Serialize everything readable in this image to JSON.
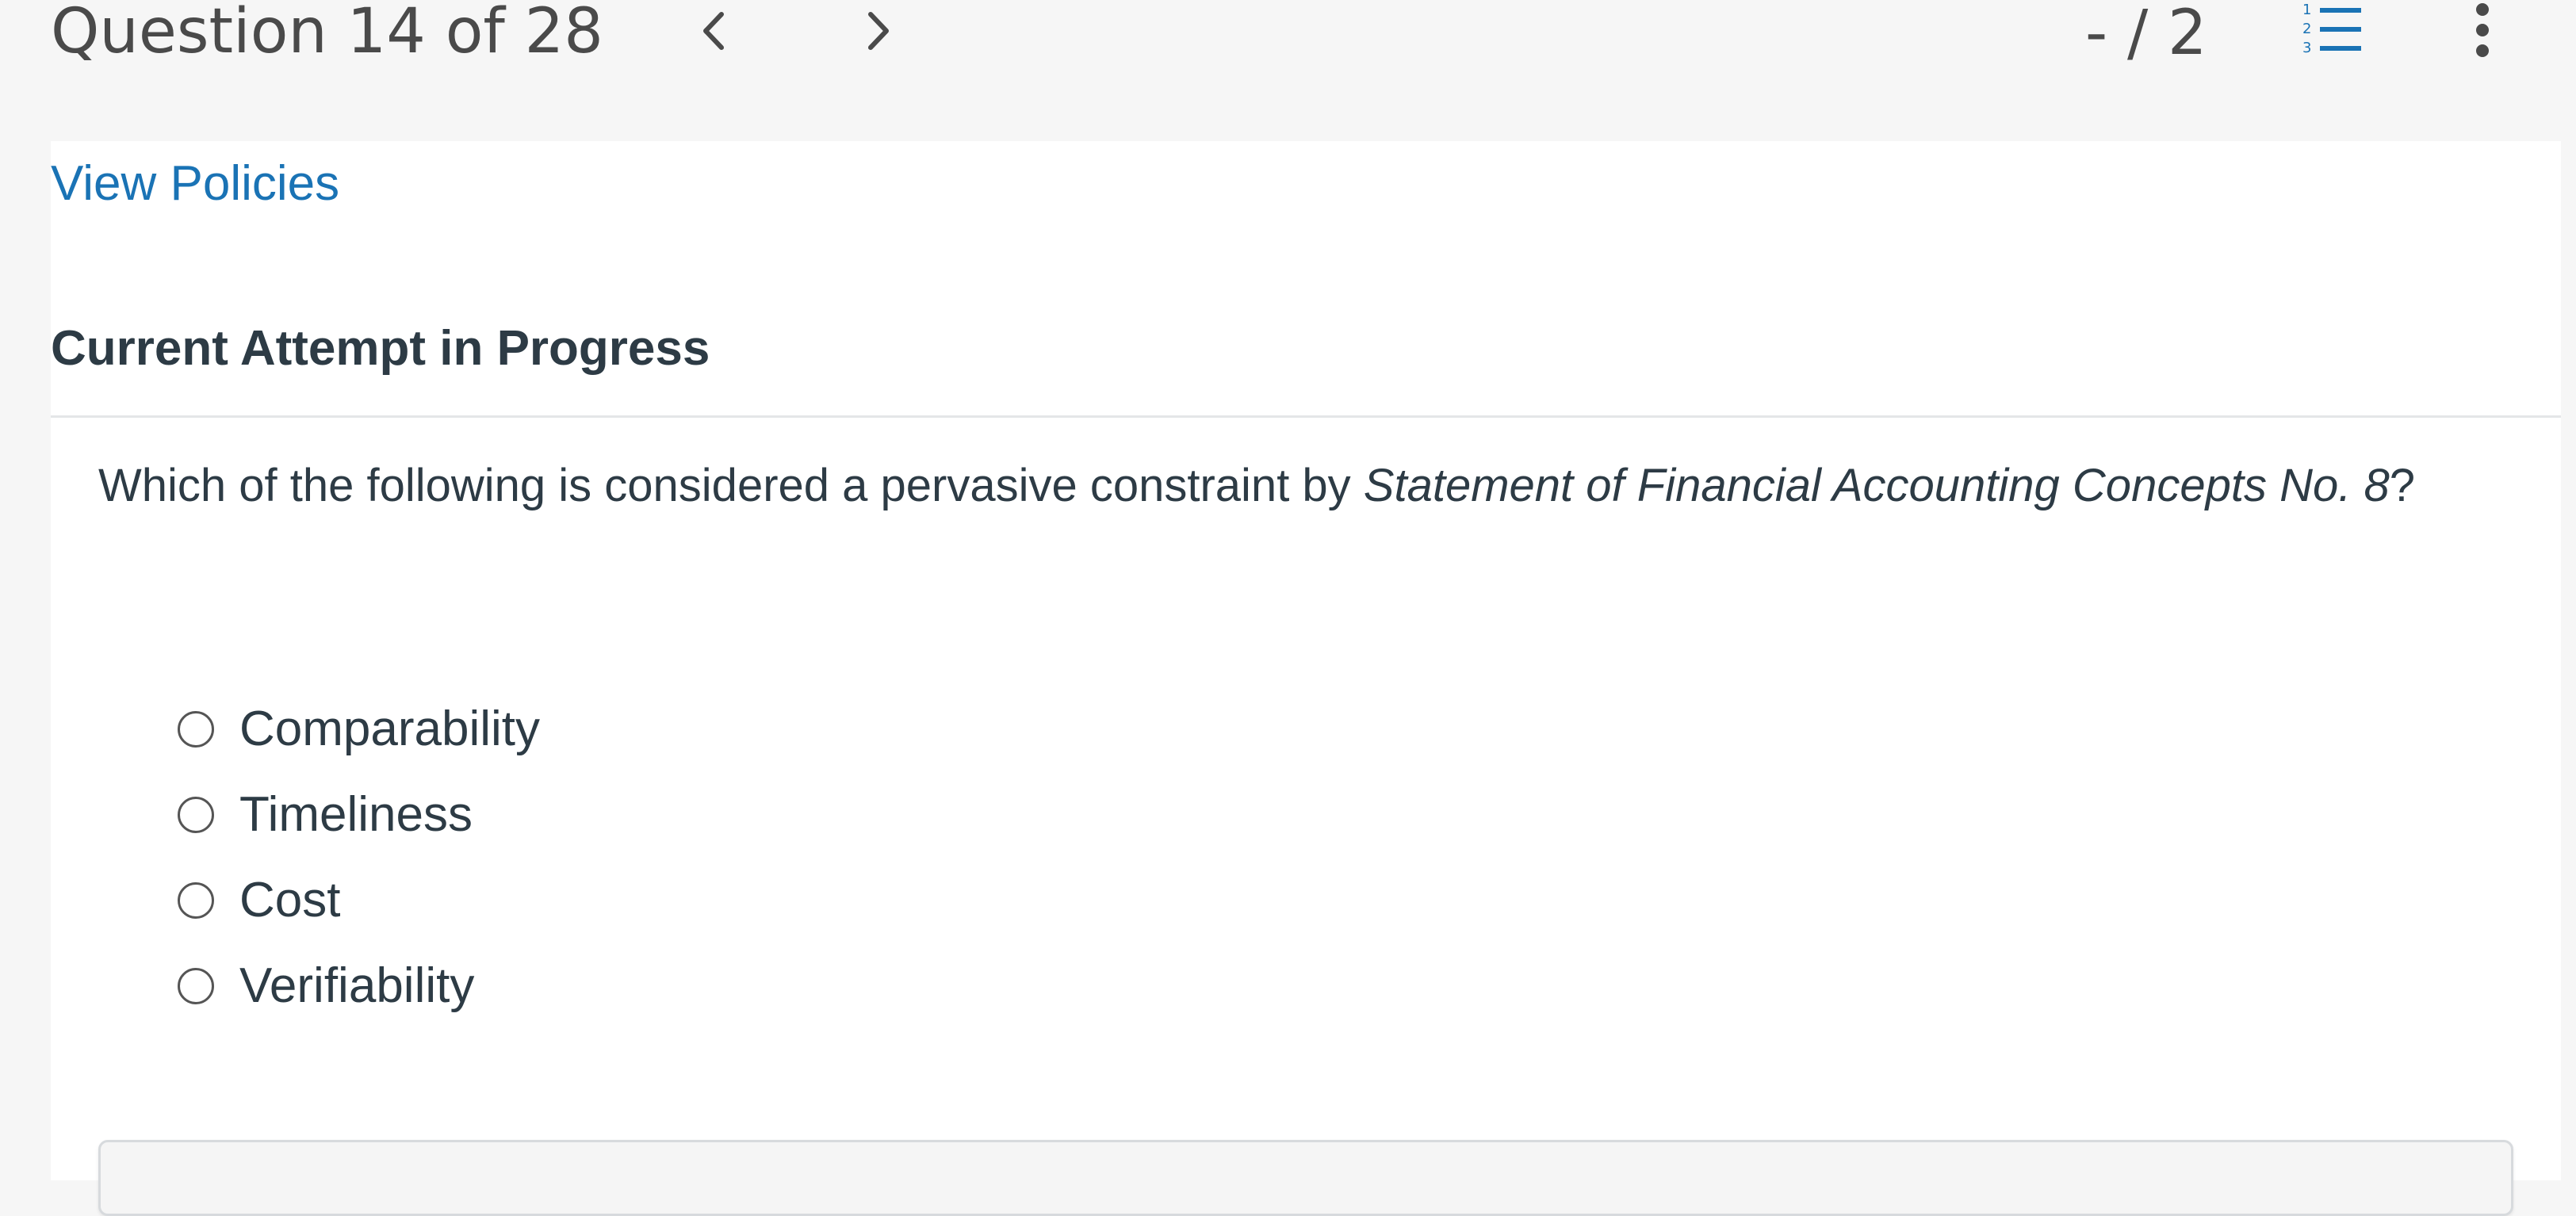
{
  "header": {
    "question_counter": "Question 14 of 28",
    "score": "- / 2",
    "icons": {
      "prev": "chevron-left-icon",
      "next": "chevron-right-icon",
      "list": "numbered-list-icon",
      "more": "kebab-menu-icon"
    },
    "accent_color": "#1a73b5"
  },
  "panel": {
    "policies_link": "View Policies",
    "attempt_heading": "Current Attempt in Progress",
    "question": {
      "prefix": "Which of the following is considered a pervasive constraint by ",
      "italic": "Statement of Financial Accounting Concepts No. 8",
      "suffix": "?"
    },
    "options": [
      {
        "label": "Comparability",
        "selected": false
      },
      {
        "label": "Timeliness",
        "selected": false
      },
      {
        "label": "Cost",
        "selected": false
      },
      {
        "label": "Verifiability",
        "selected": false
      }
    ]
  }
}
